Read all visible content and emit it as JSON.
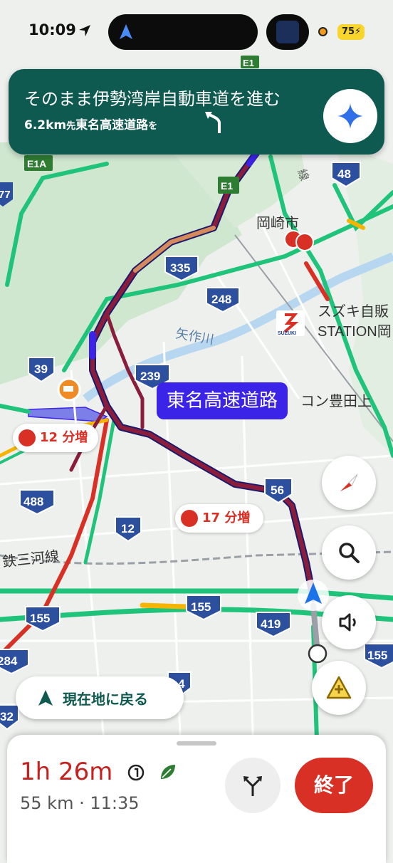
{
  "status_bar": {
    "time": "10:09",
    "battery": "75"
  },
  "banner": {
    "main_instruction": "そのまま伊勢湾岸自動車道を進む",
    "sub_distance": "6.2km",
    "sub_prefix": "先",
    "sub_road": "東名高速道路",
    "sub_suffix": "を",
    "turn_icon": "turn-slight-left-icon",
    "assistant_icon": "gemini-sparkle-icon"
  },
  "map": {
    "route_label": "東名高速道路",
    "delay_chips": [
      {
        "text": "12 分増"
      },
      {
        "text": "17 分増"
      }
    ],
    "road_shields": [
      "E1",
      "E1A",
      "E1",
      "77",
      "48",
      "335",
      "248",
      "39",
      "239",
      "488",
      "12",
      "56",
      "155",
      "155",
      "419",
      "155",
      "284",
      "32",
      "4"
    ],
    "place_labels": {
      "okazaki": "岡崎市",
      "suzuki_line1": "スズキ自販",
      "suzuki_line2": "STATION岡",
      "suzuki_logo": "SUZUKI",
      "river": "矢作川",
      "toyota": "コン豊田上",
      "railway": "鉄三河線",
      "misc_kanji": "線"
    },
    "colors": {
      "route": "#3c23e8",
      "jam": "#d93025",
      "slow": "#f4b400",
      "free": "#1fc47a"
    }
  },
  "controls": {
    "compass_icon": "compass-icon",
    "search_icon": "search-icon",
    "sound_icon": "speaker-icon",
    "report_icon": "report-incident-icon"
  },
  "recenter": {
    "label": "現在地に戻る"
  },
  "trip": {
    "duration": "1h 26m",
    "distance_eta": "55 km · 11:35",
    "alt_routes_icon": "alternate-routes-icon",
    "end_label": "終了"
  }
}
